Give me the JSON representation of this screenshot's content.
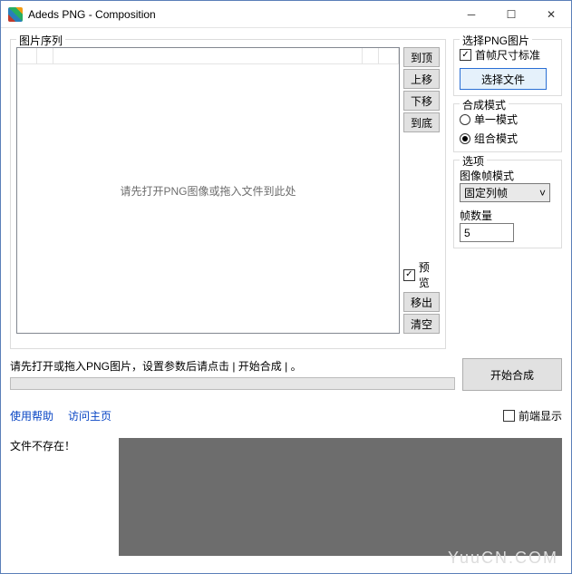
{
  "window": {
    "title": "Adeds PNG - Composition"
  },
  "sequence": {
    "legend": "图片序列",
    "placeholder": "请先打开PNG图像或拖入文件到此处",
    "buttons": {
      "top": "到顶",
      "up": "上移",
      "down": "下移",
      "bottom": "到底",
      "remove": "移出",
      "clear": "清空"
    },
    "preview_label": "预览",
    "preview_checked": true
  },
  "selectPng": {
    "legend": "选择PNG图片",
    "first_frame_label": "首帧尺寸标准",
    "first_frame_checked": true,
    "choose_button": "选择文件"
  },
  "composeMode": {
    "legend": "合成模式",
    "single_label": "单一模式",
    "combo_label": "组合模式",
    "selected": "combo"
  },
  "options": {
    "legend": "选项",
    "frame_mode_label": "图像帧模式",
    "frame_mode_value": "固定列帧",
    "frame_count_label": "帧数量",
    "frame_count_value": "5"
  },
  "status": {
    "hint": "请先打开或拖入PNG图片，设置参数后请点击 |  开始合成 |  。",
    "start_button": "开始合成"
  },
  "links": {
    "help": "使用帮助",
    "home": "访问主页",
    "topmost_label": "前端显示",
    "topmost_checked": false
  },
  "bottom": {
    "error": "文件不存在！"
  },
  "watermark": "YuuCN.COM"
}
